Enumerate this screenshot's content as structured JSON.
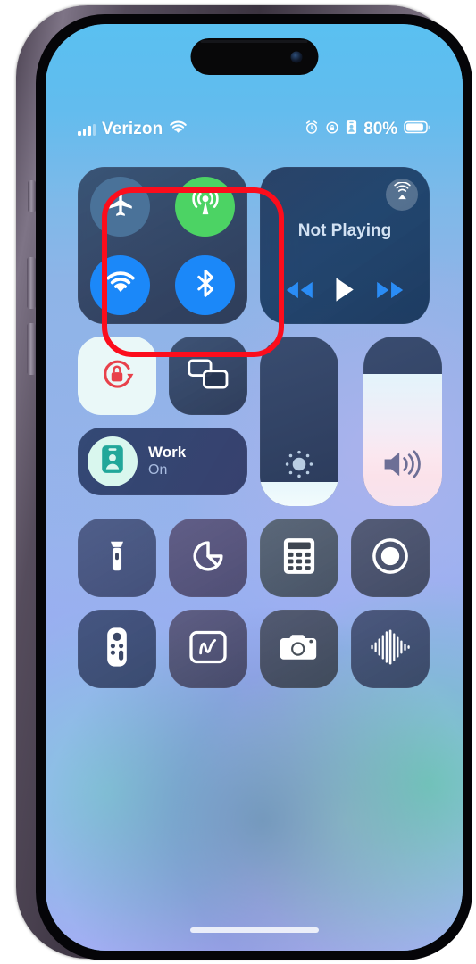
{
  "device": {
    "model_shape": "iphone-14-pro",
    "screen_label": "ios-control-center"
  },
  "status_bar": {
    "carrier": "Verizon",
    "battery_percent": "80%",
    "signal_icon": "signal-strength-icon",
    "wifi_icon": "wifi-icon",
    "alarm_icon": "alarm-clock-icon",
    "rotation_lock_icon": "rotation-lock-icon",
    "focus_badge_icon": "focus-badge-icon",
    "battery_icon": "battery-icon"
  },
  "connectivity": {
    "highlighted": true,
    "highlight_color": "#fc0d1c",
    "toggles": [
      {
        "name": "airplane-mode",
        "icon": "airplane-icon",
        "state": "off",
        "color": "#4a7299"
      },
      {
        "name": "cellular-data",
        "icon": "cellular-antenna-icon",
        "state": "on",
        "color": "#4cd364"
      },
      {
        "name": "wifi",
        "icon": "wifi-icon",
        "state": "on",
        "color": "#1b88f9"
      },
      {
        "name": "bluetooth",
        "icon": "bluetooth-icon",
        "state": "on",
        "color": "#1b88f9"
      }
    ]
  },
  "media": {
    "now_playing": "Not Playing",
    "airplay_icon": "airplay-audio-icon",
    "rewind_icon": "rewind-icon",
    "play_icon": "play-icon",
    "forward_icon": "fast-forward-icon",
    "accent_color": "#1b88f9"
  },
  "tiles": {
    "rotation_lock": {
      "icon": "rotation-lock-icon",
      "state": "on",
      "icon_color": "#e8414b"
    },
    "screen_mirroring": {
      "icon": "screen-mirroring-icon",
      "state": "off"
    }
  },
  "focus": {
    "name": "Work",
    "status": "On",
    "icon": "id-badge-icon",
    "icon_color": "#21a79a"
  },
  "sliders": [
    {
      "name": "brightness",
      "icon": "brightness-icon",
      "value": 14
    },
    {
      "name": "volume",
      "icon": "speaker-wave-icon",
      "value": 78
    }
  ],
  "utilities": [
    [
      {
        "name": "flashlight",
        "icon": "flashlight-icon"
      },
      {
        "name": "timer",
        "icon": "timer-icon"
      },
      {
        "name": "calculator",
        "icon": "calculator-icon"
      },
      {
        "name": "screen-record",
        "icon": "screen-record-icon"
      }
    ],
    [
      {
        "name": "apple-tv-remote",
        "icon": "tv-remote-icon"
      },
      {
        "name": "quick-note",
        "icon": "quick-note-icon"
      },
      {
        "name": "camera",
        "icon": "camera-icon"
      },
      {
        "name": "shazam",
        "icon": "sound-recognition-icon"
      }
    ]
  ],
  "home_indicator": {
    "visible": true
  }
}
